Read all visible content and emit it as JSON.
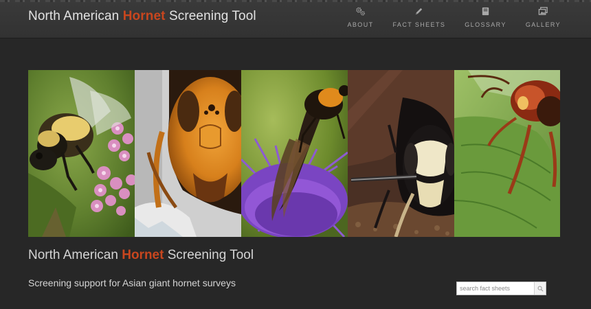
{
  "brand": {
    "prefix": "North American ",
    "highlight": "Hornet",
    "suffix": " Screening Tool"
  },
  "nav": {
    "items": [
      {
        "label": "ABOUT",
        "icon": "gears-icon"
      },
      {
        "label": "FACT SHEETS",
        "icon": "pencil-icon"
      },
      {
        "label": "GLOSSARY",
        "icon": "book-icon"
      },
      {
        "label": "GALLERY",
        "icon": "images-icon"
      }
    ]
  },
  "hero": {
    "images": [
      {
        "subject": "bumble-bee-on-milkweed"
      },
      {
        "subject": "asian-giant-hornet-face"
      },
      {
        "subject": "wasp-on-thistle"
      },
      {
        "subject": "bald-faced-hornet-face"
      },
      {
        "subject": "european-hornet-on-leaf"
      }
    ]
  },
  "main": {
    "title_prefix": "North American ",
    "title_highlight": "Hornet",
    "title_suffix": " Screening Tool",
    "tagline": "Screening support for Asian giant hornet surveys"
  },
  "search": {
    "placeholder": "search fact sheets",
    "button_icon": "search-icon"
  },
  "colors": {
    "background": "#272727",
    "navbar": "#353535",
    "accent": "#c8461e",
    "text": "#e2e2e2"
  }
}
